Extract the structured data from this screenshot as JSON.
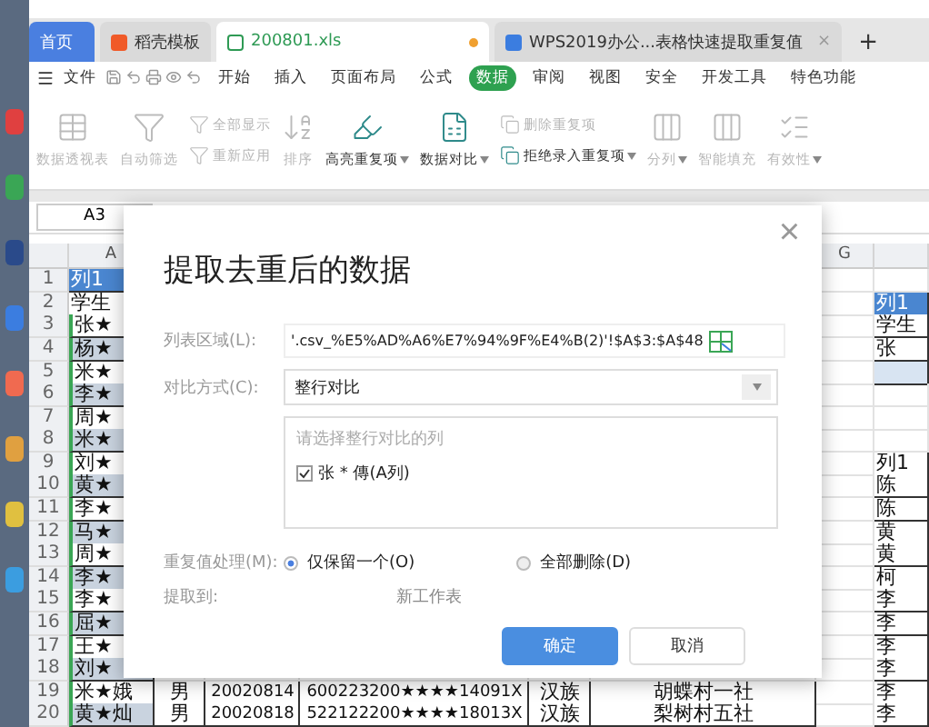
{
  "tabs": [
    {
      "label": "首页",
      "kind": "home",
      "selected": false
    },
    {
      "label": "稻壳模板",
      "kind": "docer",
      "selected": false
    },
    {
      "label": "200801.xls",
      "kind": "sheet",
      "selected": true,
      "modified": true
    },
    {
      "label": "WPS2019办公...表格快速提取重复值",
      "kind": "writer",
      "selected": false,
      "close": "×"
    }
  ],
  "new_tab": "+",
  "menu": {
    "file": "文件",
    "items": [
      {
        "label": "开始",
        "selected": false
      },
      {
        "label": "插入",
        "selected": false
      },
      {
        "label": "页面布局",
        "selected": false
      },
      {
        "label": "公式",
        "selected": false
      },
      {
        "label": "数据",
        "selected": true
      },
      {
        "label": "审阅",
        "selected": false
      },
      {
        "label": "视图",
        "selected": false
      },
      {
        "label": "安全",
        "selected": false
      },
      {
        "label": "开发工具",
        "selected": false
      },
      {
        "label": "特色功能",
        "selected": false
      }
    ]
  },
  "ribbon": [
    {
      "kind": "large",
      "label": "数据透视表",
      "disabled": true,
      "caret": false
    },
    {
      "kind": "large",
      "label": "自动筛选",
      "disabled": true,
      "caret": false
    },
    {
      "kind": "stack",
      "items": [
        {
          "label": "全部显示",
          "disabled": true,
          "caret": false
        },
        {
          "label": "重新应用",
          "disabled": true,
          "caret": false
        }
      ]
    },
    {
      "kind": "large",
      "label": "排序",
      "disabled": true,
      "caret": false
    },
    {
      "kind": "large",
      "label": "高亮重复项",
      "disabled": false,
      "caret": true
    },
    {
      "kind": "large",
      "label": "数据对比",
      "disabled": false,
      "caret": true
    },
    {
      "kind": "stack",
      "items": [
        {
          "label": "删除重复项",
          "disabled": true,
          "caret": false
        },
        {
          "label": "拒绝录入重复项",
          "disabled": false,
          "caret": true
        }
      ]
    },
    {
      "kind": "large",
      "label": "分列",
      "disabled": true,
      "caret": true
    },
    {
      "kind": "large",
      "label": "智能填充",
      "disabled": true,
      "caret": false
    },
    {
      "kind": "large",
      "label": "有效性",
      "disabled": true,
      "caret": true
    }
  ],
  "name_box": "A3",
  "column_headers": {
    "a": "A",
    "g": "G"
  },
  "rows": [
    {
      "number": "1",
      "a": "列1",
      "a_selected": true,
      "shaded": false
    },
    {
      "number": "2",
      "a": "学生",
      "h": "列1",
      "h_selected": true,
      "shaded": false
    },
    {
      "number": "3",
      "a": "张★",
      "h": "学生",
      "shaded": false
    },
    {
      "number": "4",
      "a": "杨★",
      "h": "张",
      "shaded": true
    },
    {
      "number": "5",
      "a": "米★",
      "shaded": false,
      "h_tinted": true
    },
    {
      "number": "6",
      "a": "李★",
      "shaded": true
    },
    {
      "number": "7",
      "a": "周★",
      "shaded": false
    },
    {
      "number": "8",
      "a": "米★",
      "shaded": true
    },
    {
      "number": "9",
      "a": "刘★",
      "h": "列1",
      "shaded": false
    },
    {
      "number": "10",
      "a": "黄★",
      "h": "陈",
      "shaded": true
    },
    {
      "number": "11",
      "a": "李★",
      "h": "陈",
      "shaded": false
    },
    {
      "number": "12",
      "a": "马★",
      "h": "黄",
      "shaded": true
    },
    {
      "number": "13",
      "a": "周★",
      "h": "黄",
      "shaded": false
    },
    {
      "number": "14",
      "a": "李★",
      "h": "柯",
      "shaded": true
    },
    {
      "number": "15",
      "a": "李★",
      "h": "李",
      "shaded": false
    },
    {
      "number": "16",
      "a": "屈★",
      "h": "李",
      "shaded": true
    },
    {
      "number": "17",
      "a": "王★",
      "h": "李",
      "shaded": false
    },
    {
      "number": "18",
      "a": "刘★",
      "h": "李",
      "shaded": true
    },
    {
      "number": "19",
      "a": "米★娥",
      "b": "男",
      "c": "20020814",
      "d": "600223200★★★★14091X",
      "e": "汉族",
      "f": "胡蝶村一社",
      "h": "李",
      "shaded": false
    },
    {
      "number": "20",
      "a": "黄★灿",
      "b": "男",
      "c": "20020818",
      "d": "522122200★★★★18013X",
      "e": "汉族",
      "f": "梨树村五社",
      "h": "李",
      "shaded": true
    }
  ],
  "dialog": {
    "title": "提取去重后的数据",
    "close": "×",
    "range_label": "列表区域(L):",
    "range_value": "'.csv_%E5%AD%A6%E7%94%9F%E4%B(2)'!$A$3:$A$48",
    "compare_label": "对比方式(C):",
    "compare_value": "整行对比",
    "columns_hint": "请选择整行对比的列",
    "columns": [
      {
        "label": "张 * 傳(A列)",
        "checked": true
      }
    ],
    "duplicate_label": "重复值处理(M):",
    "duplicate_options": [
      {
        "label": "仅保留一个(O)",
        "selected": true
      },
      {
        "label": "全部删除(D)",
        "selected": false
      }
    ],
    "target_label": "提取到:",
    "target_value": "新工作表",
    "buttons": [
      {
        "label": "确定",
        "kind": "primary"
      },
      {
        "label": "取消",
        "kind": "secondary"
      }
    ]
  }
}
